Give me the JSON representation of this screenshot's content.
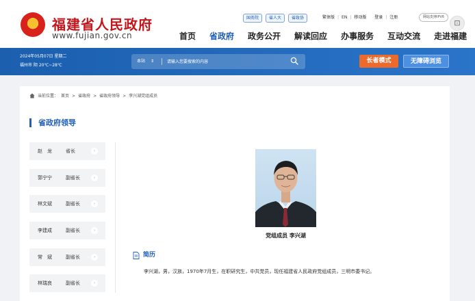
{
  "header": {
    "site_name": "福建省人民政府",
    "site_url": "www.fujian.gov.cn",
    "badges": [
      "国务院",
      "省人大",
      "省政协"
    ],
    "links": [
      "繁体版",
      "EN",
      "移动版",
      "登录",
      "注册"
    ],
    "ipv6": "网站支持IPV6",
    "nav": [
      "首页",
      "省政府",
      "政务公开",
      "解读回应",
      "办事服务",
      "互动交流",
      "走进福建"
    ],
    "side_icon": "⊡"
  },
  "bar": {
    "date": "2024年05月07日 星期二",
    "weather": "福州市 阴 20℃~28℃",
    "scope": "本站",
    "scope_arrow": "⇕",
    "search_placeholder": "请输入您要搜索的内容",
    "elder_mode": "长者模式",
    "accessible": "无障碍浏览"
  },
  "breadcrumb": {
    "label": "当前位置：",
    "items": [
      "首页",
      ">",
      "省政府",
      ">",
      "省政府领导",
      ">",
      "李兴湖党组成员"
    ]
  },
  "section_title": "省政府领导",
  "leaders": [
    {
      "name": "赵　龙",
      "title": "省长"
    },
    {
      "name": "郭宁宁",
      "title": "副省长"
    },
    {
      "name": "林文斌",
      "title": "副省长"
    },
    {
      "name": "李建成",
      "title": "副省长"
    },
    {
      "name": "常　斌",
      "title": "副省长"
    },
    {
      "name": "林瑞良",
      "title": "副省长"
    }
  ],
  "leader_arrow": "›",
  "profile": {
    "caption": "党组成员 李兴湖",
    "bio_title": "简历",
    "bio": "李兴湖，男，汉族，1970年7月生，在职研究生，中共党员，现任福建省人民政府党组成员，三明市委书记。"
  },
  "colors": {
    "brand_red": "#c4161c",
    "brand_blue": "#1f5fb8",
    "elder_orange": "#ec6a2c"
  },
  "icons": [
    "emblem-icon",
    "home-icon",
    "search-icon",
    "doc-icon",
    "chevron-right-icon"
  ]
}
